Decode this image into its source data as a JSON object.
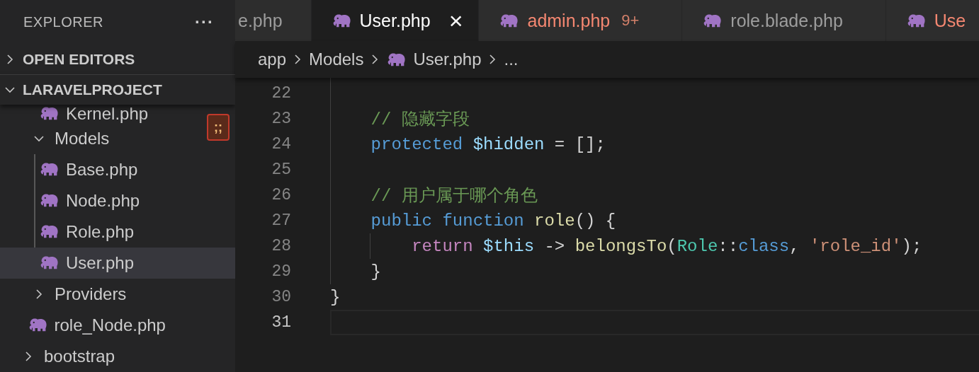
{
  "sidebar": {
    "title": "EXPLORER",
    "more": "···",
    "sections": [
      {
        "label": "OPEN EDITORS",
        "expanded": false
      },
      {
        "label": "LARAVELPROJECT",
        "expanded": true
      }
    ],
    "tree": {
      "continued": [
        {
          "name": "Kernel.php",
          "kind": "file",
          "selected": false
        }
      ],
      "items": [
        {
          "name": "Models",
          "kind": "folder",
          "expanded": true,
          "children": [
            {
              "name": "Base.php",
              "kind": "file",
              "selected": false
            },
            {
              "name": "Node.php",
              "kind": "file",
              "selected": false
            },
            {
              "name": "Role.php",
              "kind": "file",
              "selected": false
            },
            {
              "name": "User.php",
              "kind": "file",
              "selected": true
            }
          ]
        },
        {
          "name": "Providers",
          "kind": "folder",
          "expanded": false
        },
        {
          "name": "role_Node.php",
          "kind": "file",
          "selected": false
        }
      ],
      "after": [
        {
          "name": "bootstrap",
          "kind": "folder",
          "expanded": false
        }
      ]
    },
    "badge": ";;"
  },
  "tabs": [
    {
      "label": "e.php",
      "selected": false,
      "icon": false,
      "problem": false
    },
    {
      "label": "User.php",
      "selected": true,
      "icon": true,
      "problem": false,
      "close": "×"
    },
    {
      "label": "admin.php",
      "selected": false,
      "icon": true,
      "problem": true,
      "count": "9+"
    },
    {
      "label": "role.blade.php",
      "selected": false,
      "icon": true,
      "problem": false
    },
    {
      "label": "Use",
      "selected": false,
      "icon": true,
      "problem": true
    }
  ],
  "breadcrumb": [
    {
      "label": "app",
      "icon": false
    },
    {
      "label": "Models",
      "icon": false
    },
    {
      "label": "User.php",
      "icon": true
    },
    {
      "label": "...",
      "icon": false
    }
  ],
  "code": [
    {
      "number": "22",
      "current": false
    },
    {
      "number": "23",
      "current": false,
      "tokens": [
        {
          "text": "    // 隐藏字段",
          "kind": "comment"
        }
      ]
    },
    {
      "number": "24",
      "current": false,
      "tokens": [
        {
          "text": "    protected ",
          "kind": "keyword"
        },
        {
          "text": "$hidden",
          "kind": "variable"
        },
        {
          "text": " = [];",
          "kind": "plain"
        }
      ]
    },
    {
      "number": "25",
      "current": false
    },
    {
      "number": "26",
      "current": false,
      "tokens": [
        {
          "text": "    // 用户属于哪个角色",
          "kind": "comment"
        }
      ]
    },
    {
      "number": "27",
      "current": false,
      "tokens": [
        {
          "text": "    public function ",
          "kind": "keyword"
        },
        {
          "text": "role",
          "kind": "function"
        },
        {
          "text": "() {",
          "kind": "plain"
        }
      ]
    },
    {
      "number": "28",
      "current": false,
      "tokens": [
        {
          "text": "        return ",
          "kind": "control"
        },
        {
          "text": "$this",
          "kind": "variable"
        },
        {
          "text": " -> ",
          "kind": "plain"
        },
        {
          "text": "belongsTo",
          "kind": "function"
        },
        {
          "text": "(",
          "kind": "plain"
        },
        {
          "text": "Role",
          "kind": "type"
        },
        {
          "text": "::",
          "kind": "plain"
        },
        {
          "text": "class",
          "kind": "keyword"
        },
        {
          "text": ", ",
          "kind": "plain"
        },
        {
          "text": "'role_id'",
          "kind": "string"
        },
        {
          "text": ");",
          "kind": "plain"
        }
      ]
    },
    {
      "number": "29",
      "current": false,
      "tokens": [
        {
          "text": "    }",
          "kind": "plain"
        }
      ]
    },
    {
      "number": "30",
      "current": false,
      "tokens": [
        {
          "text": "}",
          "kind": "plain"
        }
      ]
    },
    {
      "number": "31",
      "current": true
    }
  ]
}
